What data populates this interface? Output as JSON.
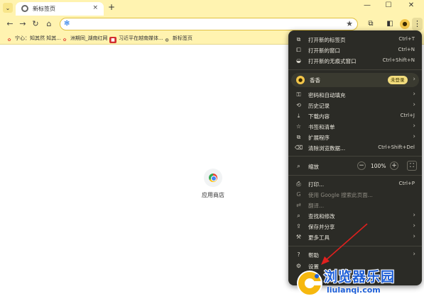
{
  "tab": {
    "title": "新标签页",
    "close": "×",
    "new": "+"
  },
  "window": {
    "minimize": "—",
    "maximize": "☐",
    "close": "✕"
  },
  "toolbar": {
    "back": "←",
    "forward": "→",
    "reload": "↻",
    "home": "⌂",
    "omnibox_value": "",
    "star": "★",
    "extensions": "⧉",
    "sidepanel": "◧",
    "menu": "⋮"
  },
  "bookmarks": [
    {
      "label": "宁心：知其然 知其...",
      "icon": "bookmark-site-icon",
      "color": "#e0463c"
    },
    {
      "label": "洲期同_湖南红网",
      "icon": "bookmark-site-icon",
      "color": "#e0463c"
    },
    {
      "label": "习近平在越南媒体...",
      "icon": "bookmark-news-icon",
      "color": "#d32f2f"
    },
    {
      "label": "新标签页",
      "icon": "bookmark-globe-icon",
      "color": "#333333"
    }
  ],
  "content": {
    "shortcut_label": "应用商店",
    "shortcut_icon": "web-store-icon"
  },
  "menu": {
    "items_top": [
      {
        "icon": "new-tab-icon",
        "glyph": "⧉",
        "label": "打开新的标签页",
        "shortcut": "Ctrl+T"
      },
      {
        "icon": "new-window-icon",
        "glyph": "⧠",
        "label": "打开新的窗口",
        "shortcut": "Ctrl+N"
      },
      {
        "icon": "incognito-icon",
        "glyph": "◒",
        "label": "打开新的无痕式窗口",
        "shortcut": "Ctrl+Shift+N"
      }
    ],
    "profile": {
      "name": "香香",
      "badge": "未登录"
    },
    "items_mid": [
      {
        "icon": "key-icon",
        "glyph": "⚿",
        "label": "密码和自动填充",
        "shortcut": "",
        "arrow": true
      },
      {
        "icon": "history-icon",
        "glyph": "⟲",
        "label": "历史记录",
        "shortcut": "",
        "arrow": true
      },
      {
        "icon": "download-icon",
        "glyph": "⤓",
        "label": "下载内容",
        "shortcut": "Ctrl+J",
        "arrow": false
      },
      {
        "icon": "bookmark-star-icon",
        "glyph": "☆",
        "label": "书签和清单",
        "shortcut": "",
        "arrow": true
      },
      {
        "icon": "extension-icon",
        "glyph": "⧉",
        "label": "扩展程序",
        "shortcut": "",
        "arrow": true
      },
      {
        "icon": "trash-icon",
        "glyph": "⌫",
        "label": "清除浏览数据...",
        "shortcut": "Ctrl+Shift+Del",
        "arrow": false
      }
    ],
    "zoom": {
      "label": "缩放",
      "value": "100%",
      "minus": "−",
      "plus": "+",
      "fullscreen": "⛶"
    },
    "items_tools": [
      {
        "icon": "print-icon",
        "glyph": "⎙",
        "label": "打印...",
        "shortcut": "Ctrl+P",
        "arrow": false,
        "dim": false
      },
      {
        "icon": "google-icon",
        "glyph": "G",
        "label": "使用 Google 搜索此页面...",
        "shortcut": "",
        "arrow": false,
        "dim": true
      },
      {
        "icon": "translate-icon",
        "glyph": "⇄",
        "label": "翻译...",
        "shortcut": "",
        "arrow": false,
        "dim": true
      },
      {
        "icon": "find-icon",
        "glyph": "⌕",
        "label": "查找和修改",
        "shortcut": "",
        "arrow": true,
        "dim": false
      },
      {
        "icon": "share-icon",
        "glyph": "⇪",
        "label": "保存并分享",
        "shortcut": "",
        "arrow": true,
        "dim": false
      },
      {
        "icon": "more-tools-icon",
        "glyph": "⚒",
        "label": "更多工具",
        "shortcut": "",
        "arrow": true,
        "dim": false
      }
    ],
    "items_bottom": [
      {
        "icon": "help-icon",
        "glyph": "?",
        "label": "帮助",
        "shortcut": "",
        "arrow": true
      },
      {
        "icon": "settings-icon",
        "glyph": "⚙",
        "label": "设置",
        "shortcut": "",
        "arrow": false
      }
    ]
  },
  "annotation": {
    "color": "#e0201e"
  },
  "watermark": {
    "title": "浏览器乐园",
    "url": "liulanqi.com",
    "color": "#1e5fd7"
  }
}
